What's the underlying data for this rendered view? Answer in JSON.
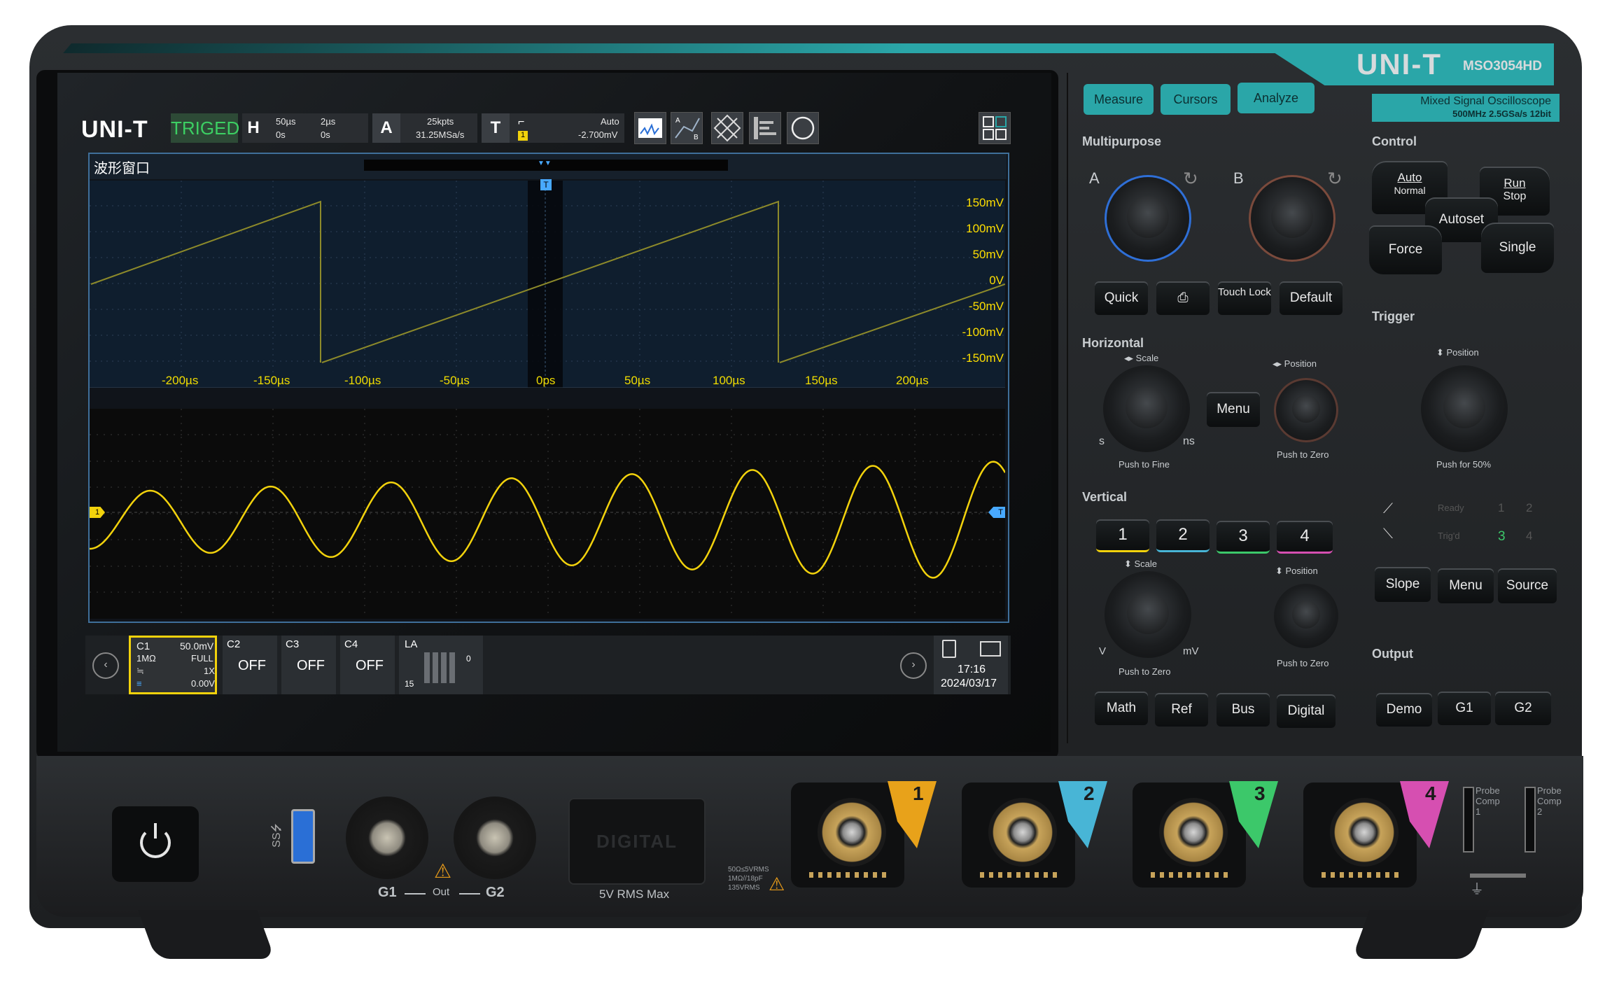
{
  "brand": {
    "logo": "UNI-T",
    "model": "MSO3054HD",
    "subtitle_line1": "Mixed Signal Oscilloscope",
    "subtitle_line2": "500MHz  2.5GSa/s  12bit"
  },
  "toolbar": {
    "logo": "UNI-T",
    "status": "TRIGED",
    "horizontal": {
      "label": "H",
      "scale": "50µs",
      "delay": "2µs",
      "pos1": "0s",
      "pos2": "0s"
    },
    "acquire": {
      "label": "A",
      "memory": "25kpts",
      "rate": "31.25MSa/s"
    },
    "trigger": {
      "label": "T",
      "mode": "Auto",
      "channel": "1",
      "level": "-2.700mV"
    }
  },
  "waveform_window": {
    "title": "波形窗口",
    "zoom_y_labels": [
      "150mV",
      "100mV",
      "50mV",
      "0V",
      "-50mV",
      "-100mV",
      "-150mV"
    ],
    "zoom_x_labels": [
      "-200µs",
      "-150µs",
      "-100µs",
      "-50µs",
      "0ps",
      "50µs",
      "100µs",
      "150µs",
      "200µs"
    ],
    "trigger_marker": "T",
    "channel_marker": "1"
  },
  "channel_bar": {
    "c1": {
      "name": "C1",
      "scale": "50.0mV",
      "impedance": "1MΩ",
      "bandwidth": "FULL",
      "probe": "1X",
      "offset": "0.00V"
    },
    "c2": {
      "name": "C2",
      "state": "OFF"
    },
    "c3": {
      "name": "C3",
      "state": "OFF"
    },
    "c4": {
      "name": "C4",
      "state": "OFF"
    },
    "la": {
      "name": "LA",
      "high": "0",
      "low": "15"
    },
    "time": "17:16",
    "date": "2024/03/17"
  },
  "panel": {
    "top_buttons": [
      "Measure",
      "Cursors",
      "Analyze"
    ],
    "multipurpose": {
      "label": "Multipurpose",
      "knob_a": "A",
      "knob_b": "B",
      "buttons": [
        "Quick",
        "Touch Lock",
        "Default"
      ]
    },
    "control": {
      "label": "Control",
      "auto_top": "Auto",
      "auto_bottom": "Normal",
      "run_top": "Run",
      "run_bottom": "Stop",
      "autoset": "Autoset",
      "force": "Force",
      "single": "Single"
    },
    "horizontal": {
      "label": "Horizontal",
      "scale": "Scale",
      "position": "Position",
      "menu": "Menu",
      "left_unit": "s",
      "right_unit": "ns",
      "push_fine": "Push to Fine",
      "push_zero": "Push to Zero"
    },
    "trigger": {
      "label": "Trigger",
      "position": "Position",
      "push50": "Push for 50%",
      "ready": "Ready",
      "trigd": "Trig'd",
      "ready_nums": [
        "1",
        "2"
      ],
      "trigd_nums": [
        "3",
        "4"
      ],
      "buttons": [
        "Slope",
        "Menu",
        "Source"
      ]
    },
    "vertical": {
      "label": "Vertical",
      "channels": [
        "1",
        "2",
        "3",
        "4"
      ],
      "scale": "Scale",
      "position": "Position",
      "left_unit": "V",
      "right_unit": "mV",
      "push_zero_left": "Push to Zero",
      "push_zero_right": "Push to Zero",
      "buttons": [
        "Math",
        "Ref",
        "Bus",
        "Digital"
      ]
    },
    "output": {
      "label": "Output",
      "buttons": [
        "Demo",
        "G1",
        "G2"
      ]
    }
  },
  "front": {
    "g1": "G1",
    "out": "Out",
    "g2": "G2",
    "digital": "DIGITAL",
    "digital_rating": "5V RMS Max",
    "input_rating": [
      "50Ω≤5VRMS",
      "1MΩ//18pF",
      "135VRMS"
    ],
    "channels": [
      "1",
      "2",
      "3",
      "4"
    ],
    "probe_comp": [
      "Probe Comp 1",
      "Probe Comp 2"
    ]
  },
  "colors": {
    "teal": "#2aa6a8",
    "ch1": "#f2d20c",
    "ch2": "#48b5d6",
    "ch3": "#3cc86a",
    "ch4": "#d64fb1",
    "ch1_flag": "#e8a21a"
  }
}
